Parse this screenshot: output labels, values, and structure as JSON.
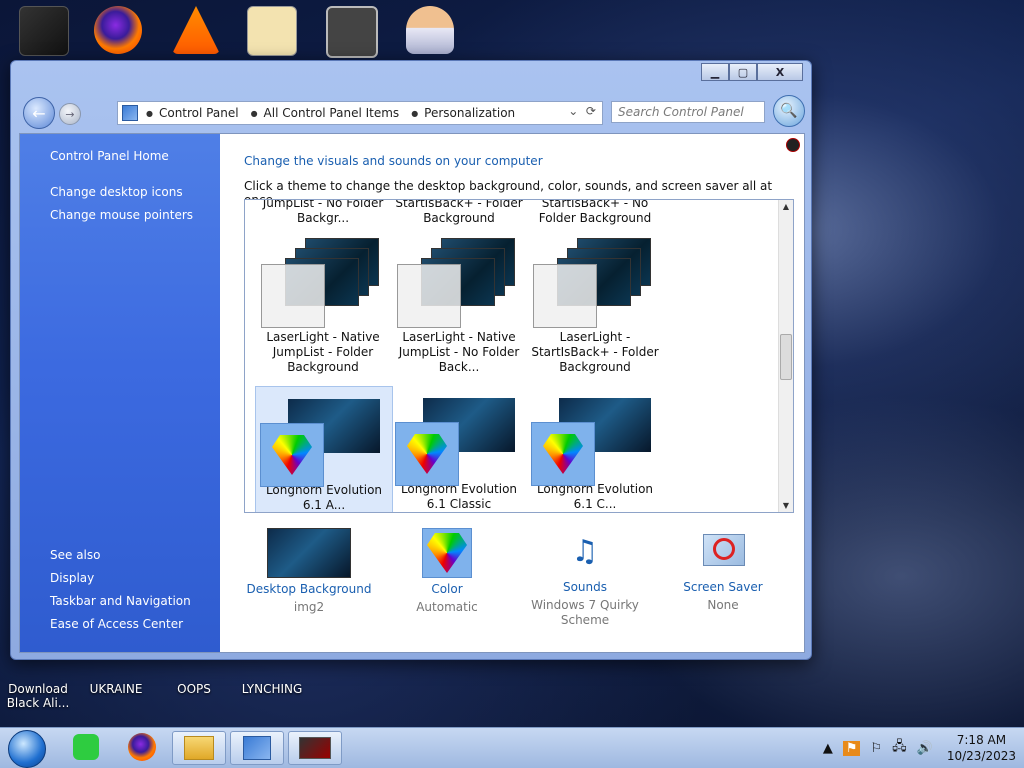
{
  "desktop": {
    "icons": [
      {
        "label": ""
      },
      {
        "label": ""
      },
      {
        "label": ""
      },
      {
        "label": ""
      },
      {
        "label": ""
      },
      {
        "label": ""
      }
    ],
    "bottom_icons": [
      {
        "label": "Download Black Ali..."
      },
      {
        "label": "UKRAINE"
      },
      {
        "label": "OOPS"
      },
      {
        "label": "LYNCHING"
      }
    ]
  },
  "window": {
    "caption": {
      "minimize": "▁",
      "maximize": "▢",
      "close": "X"
    },
    "nav": {
      "back": "←",
      "forward": "→",
      "breadcrumb": [
        "Control Panel",
        "All Control Panel Items",
        "Personalization"
      ],
      "search_placeholder": "Search Control Panel"
    },
    "sidebar": {
      "home": "Control Panel Home",
      "links": [
        "Change desktop icons",
        "Change mouse pointers"
      ],
      "see_also_title": "See also",
      "see_also": [
        "Display",
        "Taskbar and Navigation",
        "Ease of Access Center"
      ]
    },
    "main": {
      "title": "Change the visuals and sounds on your computer",
      "subtitle": "Click a theme to change the desktop background, color, sounds, and screen saver all at once.",
      "themes": [
        {
          "label": "JumpList - No Folder Backgr..."
        },
        {
          "label": "StartIsBack+ - Folder Background"
        },
        {
          "label": "StartIsBack+ - No Folder Background"
        },
        {
          "label": "LaserLight - Native JumpList - Folder Background"
        },
        {
          "label": "LaserLight - Native JumpList - No Folder Back..."
        },
        {
          "label": "LaserLight - StartIsBack+ - Folder Background"
        },
        {
          "label": "Longhorn Evolution 6.1 A..."
        },
        {
          "label": "Longhorn Evolution 6.1 Classic"
        },
        {
          "label": "Longhorn Evolution 6.1 C..."
        }
      ],
      "bottom": {
        "background": {
          "label": "Desktop Background",
          "value": "img2"
        },
        "color": {
          "label": "Color",
          "value": "Automatic"
        },
        "sounds": {
          "label": "Sounds",
          "value": "Windows 7 Quirky Scheme"
        },
        "screensaver": {
          "label": "Screen Saver",
          "value": "None"
        }
      }
    }
  },
  "taskbar": {
    "clock_time": "7:18 AM",
    "clock_date": "10/23/2023"
  }
}
